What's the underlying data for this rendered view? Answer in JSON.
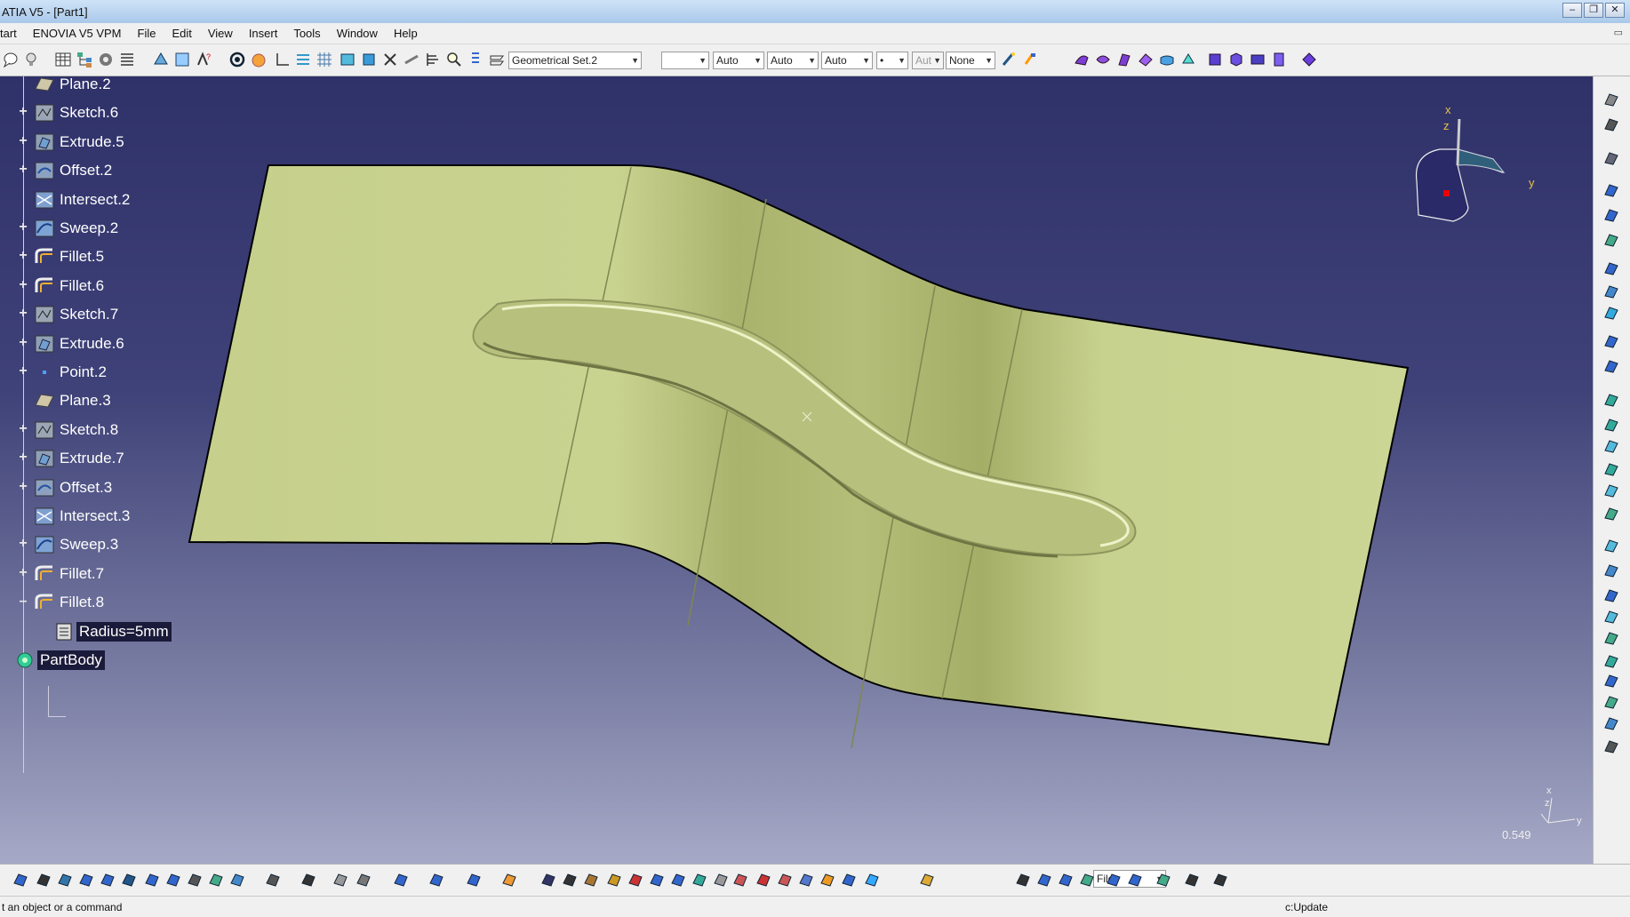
{
  "window": {
    "title": "ATIA V5 - [Part1]",
    "controls": [
      "–",
      "❐",
      "✕"
    ]
  },
  "menu": [
    "tart",
    "ENOVIA V5 VPM",
    "File",
    "Edit",
    "View",
    "Insert",
    "Tools",
    "Window",
    "Help"
  ],
  "toolbar": {
    "geometrical_set": "Geometrical Set.2",
    "color_value": "",
    "line_type": "Auto",
    "thickness": "Auto",
    "weight": "Auto",
    "point_symbol": "•",
    "layer_disabled": "Aut",
    "layer": "None"
  },
  "tree": [
    {
      "label": "Plane.2",
      "icon": "plane-icon",
      "toggle": ""
    },
    {
      "label": "Sketch.6",
      "icon": "sketch-icon",
      "toggle": "+"
    },
    {
      "label": "Extrude.5",
      "icon": "extrude-icon",
      "toggle": "+"
    },
    {
      "label": "Offset.2",
      "icon": "offset-icon",
      "toggle": "+"
    },
    {
      "label": "Intersect.2",
      "icon": "intersect-icon",
      "toggle": ""
    },
    {
      "label": "Sweep.2",
      "icon": "sweep-icon",
      "toggle": "+"
    },
    {
      "label": "Fillet.5",
      "icon": "fillet-icon",
      "toggle": "+"
    },
    {
      "label": "Fillet.6",
      "icon": "fillet-icon",
      "toggle": "+"
    },
    {
      "label": "Sketch.7",
      "icon": "sketch-icon",
      "toggle": "+"
    },
    {
      "label": "Extrude.6",
      "icon": "extrude-icon",
      "toggle": "+"
    },
    {
      "label": "Point.2",
      "icon": "point-icon",
      "toggle": "+"
    },
    {
      "label": "Plane.3",
      "icon": "plane-icon",
      "toggle": ""
    },
    {
      "label": "Sketch.8",
      "icon": "sketch-icon",
      "toggle": "+"
    },
    {
      "label": "Extrude.7",
      "icon": "extrude-icon",
      "toggle": "+"
    },
    {
      "label": "Offset.3",
      "icon": "offset-icon",
      "toggle": "+"
    },
    {
      "label": "Intersect.3",
      "icon": "intersect-icon",
      "toggle": ""
    },
    {
      "label": "Sweep.3",
      "icon": "sweep-icon",
      "toggle": "+"
    },
    {
      "label": "Fillet.7",
      "icon": "fillet-icon",
      "toggle": "+"
    },
    {
      "label": "Fillet.8",
      "icon": "fillet-icon",
      "toggle": "–"
    }
  ],
  "tree_child": {
    "label": "Radius=5mm",
    "icon": "parameter-icon"
  },
  "tree_root": {
    "label": "PartBody",
    "icon": "partbody-icon"
  },
  "compass": {
    "x": "x",
    "y": "y",
    "z": "z"
  },
  "mini_axes": {
    "x": "x",
    "y": "y",
    "z": "z"
  },
  "zoom_level": "0.549",
  "bottom_toolbar": {
    "file_combo": "File"
  },
  "status": {
    "message": "t an object or a command",
    "command_input": "c:Update"
  },
  "colors": {
    "surface": "#c9d38e",
    "background_top": "#2f3169",
    "background_bottom": "#a6a9c6",
    "tree_text": "#ffffff"
  }
}
